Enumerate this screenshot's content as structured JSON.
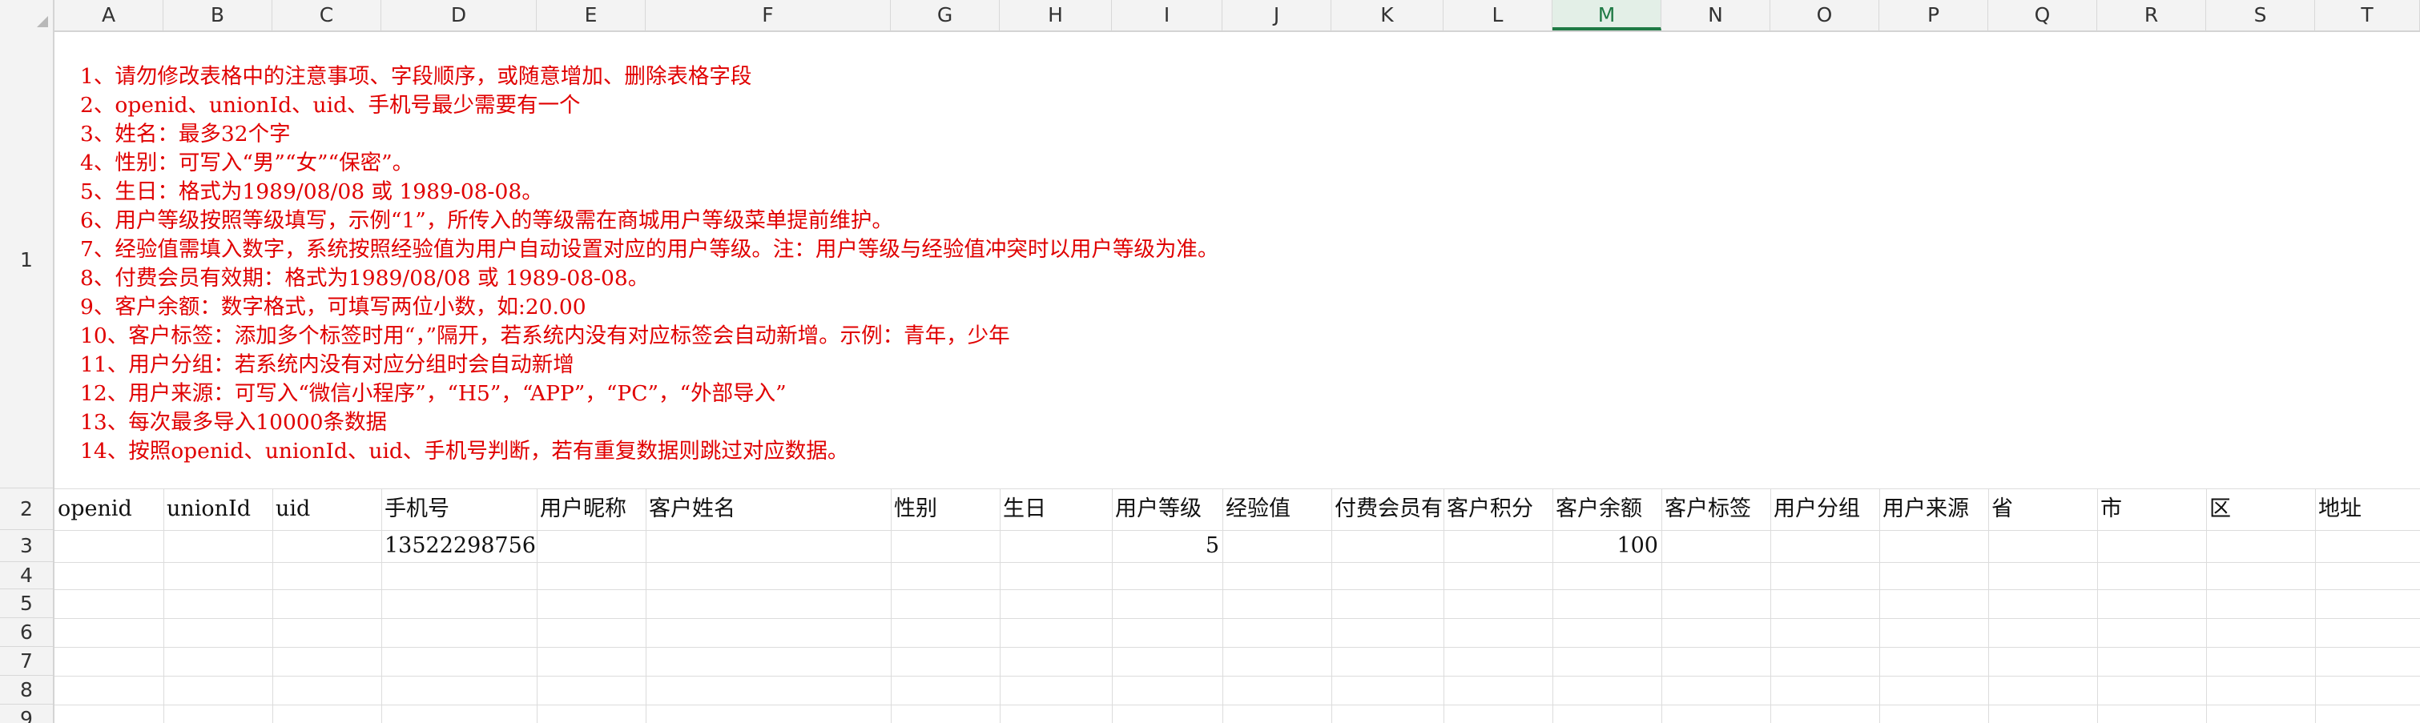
{
  "columns": [
    "A",
    "B",
    "C",
    "D",
    "E",
    "F",
    "G",
    "H",
    "I",
    "J",
    "K",
    "L",
    "M",
    "N",
    "O",
    "P",
    "Q",
    "R",
    "S",
    "T"
  ],
  "selected_column": "M",
  "rows": [
    "1",
    "2",
    "3",
    "4",
    "5",
    "6",
    "7",
    "8",
    "9"
  ],
  "notes": [
    "1、请勿修改表格中的注意事项、字段顺序，或随意增加、删除表格字段",
    "2、openid、unionId、uid、手机号最少需要有一个",
    "3、姓名：最多32个字",
    "4、性别：可写入“男”“女”“保密”。",
    "5、生日：格式为1989/08/08 或 1989-08-08。",
    "6、用户等级按照等级填写，示例“1”，所传入的等级需在商城用户等级菜单提前维护。",
    "7、经验值需填入数字，系统按照经验值为用户自动设置对应的用户等级。注：用户等级与经验值冲突时以用户等级为准。",
    "8、付费会员有效期：格式为1989/08/08 或 1989-08-08。",
    "9、客户余额：数字格式，可填写两位小数，如:20.00",
    "10、客户标签：添加多个标签时用“，”隔开，若系统内没有对应标签会自动新增。示例：青年，少年",
    "11、用户分组：若系统内没有对应分组时会自动新增",
    "12、用户来源：可写入“微信小程序”，“H5”，“APP”，“PC”，“外部导入”",
    "13、每次最多导入10000条数据",
    "14、按照openid、unionId、uid、手机号判断，若有重复数据则跳过对应数据。"
  ],
  "headers": [
    "openid",
    "unionId",
    "uid",
    "手机号",
    "用户昵称",
    "客户姓名",
    "性别",
    "生日",
    "用户等级",
    "经验值",
    "付费会员有",
    "客户积分",
    "客户余额",
    "客户标签",
    "用户分组",
    "用户来源",
    "省",
    "市",
    "区",
    "地址"
  ],
  "row3": {
    "phone": "13522298756",
    "level": "5",
    "balance": "100"
  },
  "colors": {
    "note_text": "#e00000",
    "selected_column_accent": "#1f7a45",
    "header_bg": "#f3f3f3",
    "gridline": "#dcdcdc"
  }
}
